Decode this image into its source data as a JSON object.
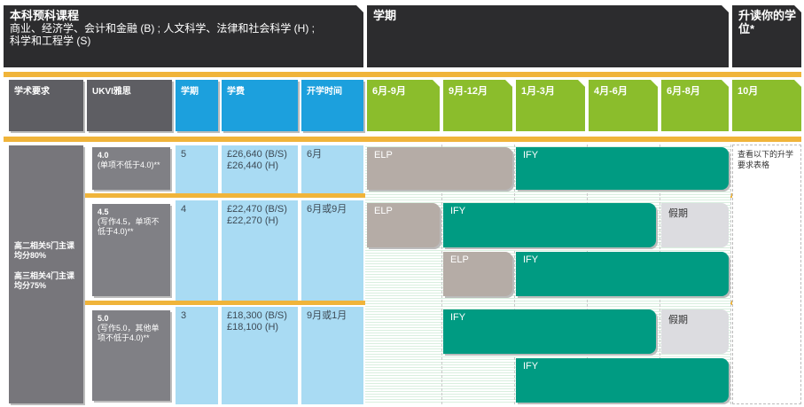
{
  "header": {
    "courses_title": "本科预科课程",
    "courses_line1": "商业、经济学、会计和金融 (B) ; 人文科学、法律和社会科学 (H) ;",
    "courses_line2": "科学和工程学 (S)",
    "term_title": "学期",
    "degree_title": "升读你的学位*"
  },
  "columns": {
    "academic": "学术要求",
    "ielts": "UKVI雅思",
    "terms": "学期",
    "fees": "学费",
    "start": "开学时间",
    "months": [
      "6月-9月",
      "9月-12月",
      "1月-3月",
      "4月-6月",
      "6月-8月",
      "10月"
    ]
  },
  "academic_req": {
    "line1": "高二相关5门主课均分80%",
    "line2": "高三相关4门主课均分75%"
  },
  "rows": [
    {
      "ielts": "4.0",
      "ielts_note": "(单项不低于4.0)**",
      "terms": "5",
      "fee_b": "£26,640 (B/S)",
      "fee_h": "£26,440 (H)",
      "start": "6月",
      "progression": "查看以下的升学要求表格"
    },
    {
      "ielts": "4.5",
      "ielts_note": "(写作4.5，单项不低于4.0)**",
      "terms": "4",
      "fee_b": "£22,470 (B/S)",
      "fee_h": "£22,270 (H)",
      "start": "6月或9月"
    },
    {
      "ielts": "5.0",
      "ielts_note": "(写作5.0，其他单项不低于4.0)**",
      "terms": "3",
      "fee_b": "£18,300 (B/S)",
      "fee_h": "£18,100 (H)",
      "start": "9月或1月"
    }
  ],
  "bars": {
    "elp": "ELP",
    "ify": "IFY",
    "holiday": "假期"
  },
  "colors": {
    "banner": "#2c2c2e",
    "band": "#f0b43a",
    "header_gray": "#5e5e63",
    "header_blue": "#1ca0dd",
    "header_green": "#8bbd2c",
    "elp": "#b5aca6",
    "ify": "#009b82",
    "holiday": "#dcdce0",
    "light_blue": "#a9dbf3"
  }
}
